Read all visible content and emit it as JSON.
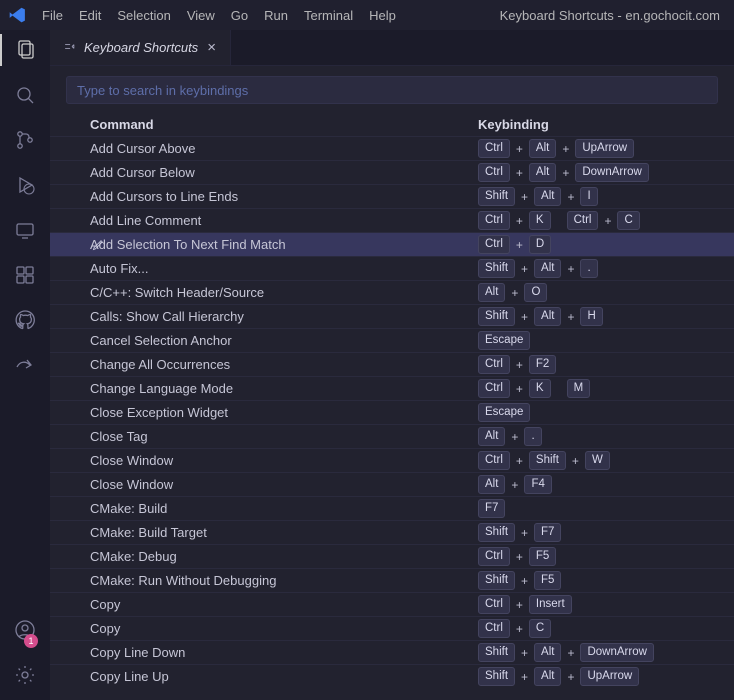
{
  "window": {
    "title": "Keyboard Shortcuts - en.gochocit.com"
  },
  "menu": {
    "file": "File",
    "edit": "Edit",
    "selection": "Selection",
    "view": "View",
    "go": "Go",
    "run": "Run",
    "terminal": "Terminal",
    "help": "Help"
  },
  "activitybar": {
    "pink_badge": "1"
  },
  "tabs": [
    {
      "label": "Keyboard Shortcuts",
      "italic": true
    }
  ],
  "search": {
    "placeholder": "Type to search in keybindings"
  },
  "grid": {
    "headers": {
      "command": "Command",
      "keybinding": "Keybinding"
    }
  },
  "rows": [
    {
      "cmd": "Add Cursor Above",
      "keys": [
        "Ctrl",
        "+",
        "Alt",
        "+",
        "UpArrow"
      ]
    },
    {
      "cmd": "Add Cursor Below",
      "keys": [
        "Ctrl",
        "+",
        "Alt",
        "+",
        "DownArrow"
      ]
    },
    {
      "cmd": "Add Cursors to Line Ends",
      "keys": [
        "Shift",
        "+",
        "Alt",
        "+",
        "I"
      ]
    },
    {
      "cmd": "Add Line Comment",
      "keys": [
        "Ctrl",
        "+",
        "K",
        " ",
        "Ctrl",
        "+",
        "C"
      ]
    },
    {
      "cmd": "Add Selection To Next Find Match",
      "keys": [
        "Ctrl",
        "+",
        "D"
      ],
      "selected": true
    },
    {
      "cmd": "Auto Fix...",
      "keys": [
        "Shift",
        "+",
        "Alt",
        "+",
        "."
      ]
    },
    {
      "cmd": "C/C++: Switch Header/Source",
      "keys": [
        "Alt",
        "+",
        "O"
      ]
    },
    {
      "cmd": "Calls: Show Call Hierarchy",
      "keys": [
        "Shift",
        "+",
        "Alt",
        "+",
        "H"
      ]
    },
    {
      "cmd": "Cancel Selection Anchor",
      "keys": [
        "Escape"
      ]
    },
    {
      "cmd": "Change All Occurrences",
      "keys": [
        "Ctrl",
        "+",
        "F2"
      ]
    },
    {
      "cmd": "Change Language Mode",
      "keys": [
        "Ctrl",
        "+",
        "K",
        " ",
        "M"
      ]
    },
    {
      "cmd": "Close Exception Widget",
      "keys": [
        "Escape"
      ]
    },
    {
      "cmd": "Close Tag",
      "keys": [
        "Alt",
        "+",
        "."
      ]
    },
    {
      "cmd": "Close Window",
      "keys": [
        "Ctrl",
        "+",
        "Shift",
        "+",
        "W"
      ]
    },
    {
      "cmd": "Close Window",
      "keys": [
        "Alt",
        "+",
        "F4"
      ]
    },
    {
      "cmd": "CMake: Build",
      "keys": [
        "F7"
      ]
    },
    {
      "cmd": "CMake: Build Target",
      "keys": [
        "Shift",
        "+",
        "F7"
      ]
    },
    {
      "cmd": "CMake: Debug",
      "keys": [
        "Ctrl",
        "+",
        "F5"
      ]
    },
    {
      "cmd": "CMake: Run Without Debugging",
      "keys": [
        "Shift",
        "+",
        "F5"
      ]
    },
    {
      "cmd": "Copy",
      "keys": [
        "Ctrl",
        "+",
        "Insert"
      ]
    },
    {
      "cmd": "Copy",
      "keys": [
        "Ctrl",
        "+",
        "C"
      ]
    },
    {
      "cmd": "Copy Line Down",
      "keys": [
        "Shift",
        "+",
        "Alt",
        "+",
        "DownArrow"
      ]
    },
    {
      "cmd": "Copy Line Up",
      "keys": [
        "Shift",
        "+",
        "Alt",
        "+",
        "UpArrow"
      ]
    }
  ]
}
